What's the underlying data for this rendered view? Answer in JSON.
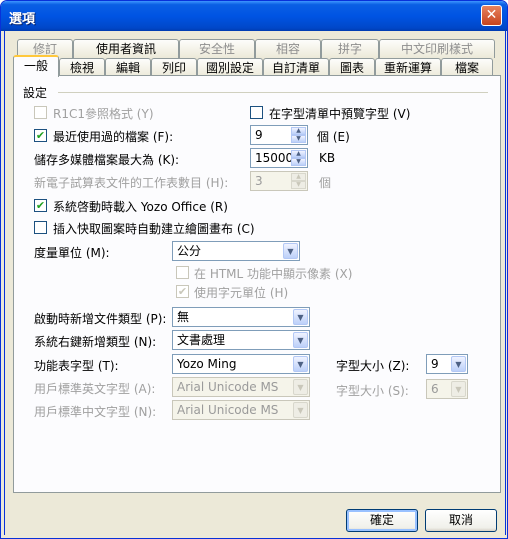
{
  "window": {
    "title": "選項",
    "close_glyph": "✕"
  },
  "tabs_back": [
    "修訂",
    "使用者資訊",
    "安全性",
    "相容",
    "拼字",
    "中文印刷樣式"
  ],
  "tabs_front": [
    "一般",
    "檢視",
    "編輯",
    "列印",
    "國別設定",
    "自訂清單",
    "圖表",
    "重新運算",
    "檔案"
  ],
  "group_title": "設定",
  "options": {
    "r1c1": {
      "label": "R1C1參照格式 (Y)",
      "checked": false,
      "enabled": false
    },
    "preview_fonts": {
      "label": "在字型清單中預覽字型 (V)",
      "checked": false,
      "enabled": true
    },
    "recent_files": {
      "label": "最近使用過的檔案 (F):",
      "checked": true,
      "enabled": true,
      "value": "9",
      "unit": "個 (E)"
    },
    "max_multimedia": {
      "label": "儲存多媒體檔案最大為 (K):",
      "value": "15000",
      "unit": "KB"
    },
    "sheets_count": {
      "label": "新電子試算表文件的工作表數目 (H):",
      "value": "3",
      "unit": "個",
      "enabled": false
    },
    "load_yozo": {
      "label": "系統啓動時載入 Yozo Office (R)",
      "checked": true,
      "enabled": true
    },
    "auto_canvas": {
      "label": "插入快取圖案時自動建立繪圖畫布 (C)",
      "checked": false,
      "enabled": true
    },
    "unit": {
      "label": "度量單位 (M):",
      "value": "公分"
    },
    "html_pixels": {
      "label": "在 HTML 功能中顯示像素 (X)",
      "checked": false,
      "enabled": false
    },
    "char_unit": {
      "label": "使用字元單位 (H)",
      "checked": true,
      "enabled": false
    },
    "new_doc_type": {
      "label": "啟動時新增文件類型 (P):",
      "value": "無"
    },
    "context_new": {
      "label": "系統右鍵新增類型 (N):",
      "value": "文書處理"
    },
    "menu_font": {
      "label": "功能表字型 (T):",
      "value": "Yozo Ming"
    },
    "menu_font_size": {
      "label": "字型大小 (Z):",
      "value": "9"
    },
    "user_en_font": {
      "label": "用戶標準英文字型 (A):",
      "value": "Arial Unicode MS",
      "enabled": false
    },
    "user_cn_font": {
      "label": "用戶標準中文字型 (N):",
      "value": "Arial Unicode MS",
      "enabled": false
    },
    "user_font_size": {
      "label": "字型大小 (S):",
      "value": "6",
      "enabled": false
    }
  },
  "buttons": {
    "ok": "確定",
    "cancel": "取消"
  },
  "icons": {
    "checked": "✔",
    "dropdown": "▼",
    "spin_up": "▲",
    "spin_down": "▼"
  },
  "colors": {
    "titlebar": "#0054e3",
    "dialog_bg": "#ece9d8",
    "active_tab_accent": "#ffc83c"
  }
}
